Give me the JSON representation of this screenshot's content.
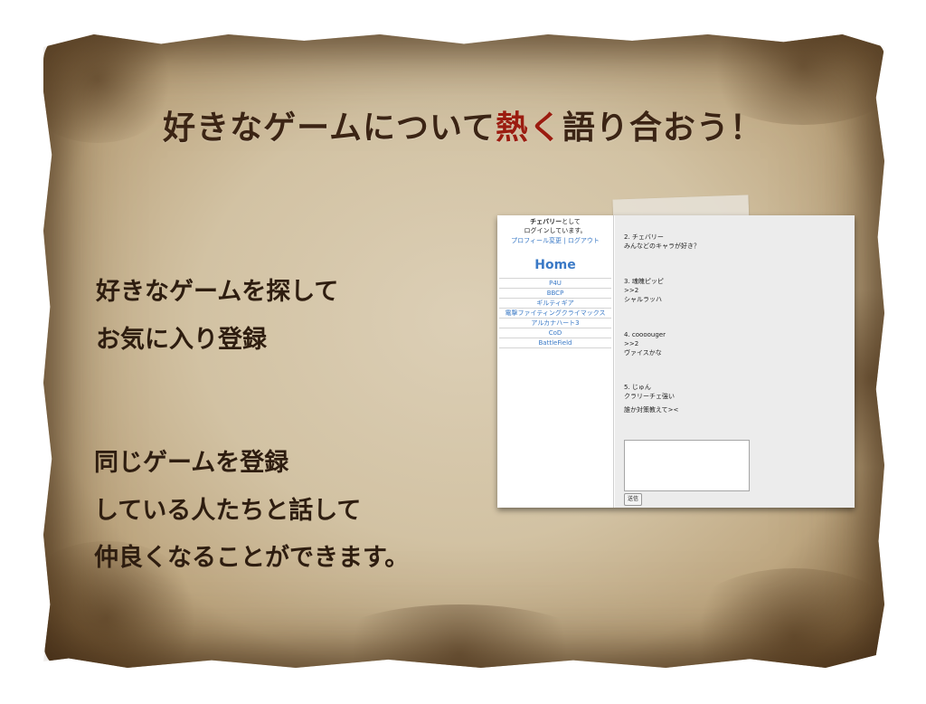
{
  "slide": {
    "headline_pre": "好きなゲームについて",
    "headline_accent": "熱く",
    "headline_post": "語り合おう！",
    "block1": [
      "好きなゲームを探して",
      "お気に入り登録"
    ],
    "block2": [
      "同じゲームを登録",
      "している人たちと話して",
      "仲良くなることができます。"
    ],
    "colors": {
      "accent": "#9b1c10",
      "text": "#3b2414"
    }
  },
  "screenshot": {
    "sidebar": {
      "user_name": "チェバリー",
      "login_suffix": "として",
      "login_line2": "ログインしています。",
      "profile_link": "プロフィール変更",
      "separator": " | ",
      "logout_link": "ログアウト",
      "home": "Home",
      "games": [
        "P4U",
        "BBCP",
        "ギルティギア",
        "電撃ファイティングクライマックス",
        "アルカナハート3",
        "CoD",
        "BattleField"
      ]
    },
    "posts": [
      {
        "header": "2.  チェバリー",
        "lines": [
          "みんなどのキャラが好き？"
        ]
      },
      {
        "header": "3.  魂魄ピッピ",
        "lines": [
          ">>2",
          "シャルラッハ"
        ]
      },
      {
        "header": "4.  coooouger",
        "lines": [
          ">>2",
          "ヴァイスかな"
        ]
      },
      {
        "header": "5.  じゅん",
        "lines": [
          "クラリーチェ強い",
          "",
          "誰か対策教えて><"
        ]
      }
    ],
    "submit_label": "送信"
  }
}
